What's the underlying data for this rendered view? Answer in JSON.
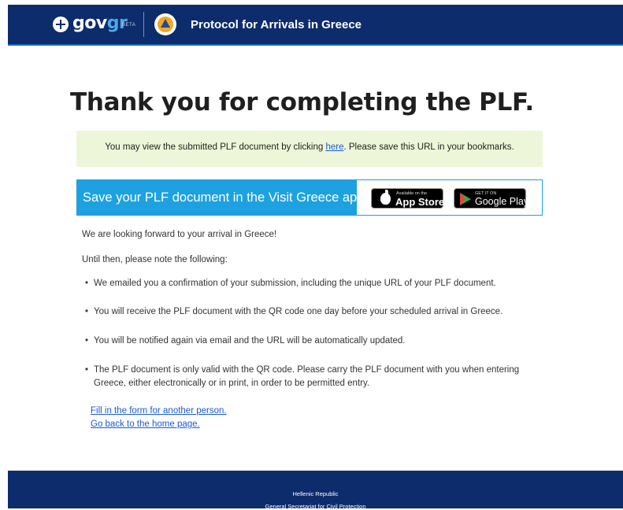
{
  "header": {
    "logo_prefix": "gov",
    "logo_suffix": "gr",
    "logo_badge": "BETA",
    "title": "Protocol for Arrivals in Greece"
  },
  "main": {
    "title": "Thank you for completing the PLF.",
    "notice": {
      "before_link": "You may view the submitted PLF document by clicking ",
      "link": "here",
      "after_link": ". Please save this URL in your bookmarks."
    },
    "app_banner": {
      "text": "Save your PLF document in the Visit Greece app",
      "app_store_small": "Available on the",
      "app_store_big": "App Store",
      "google_play_small": "GET IT ON",
      "google_play_big": "Google Play"
    },
    "intro": "We are looking forward to your arrival in Greece!",
    "until_then": "Until then, please note the following:",
    "bullets": [
      "We emailed you a confirmation of your submission, including the unique URL of your PLF document.",
      "You will receive the PLF document with the QR code one day before your scheduled arrival in Greece.",
      "You will be notified again via email and the URL will be automatically updated.",
      "The PLF document is only valid with the QR code. Please carry the PLF document with you when entering Greece, either electronically or in print, in order to be permitted entry."
    ],
    "links": {
      "another_person": "Fill in the form for another person.",
      "home": "Go back to the home page."
    }
  },
  "footer": {
    "line1": "Hellenic Republic",
    "line2": "General Secretariat for Civil Protection"
  },
  "colors": {
    "header_bg": "#0d2c6c",
    "accent_blue": "#1da1e0",
    "success_bg": "#eef6d9",
    "link": "#1a5bd6"
  }
}
